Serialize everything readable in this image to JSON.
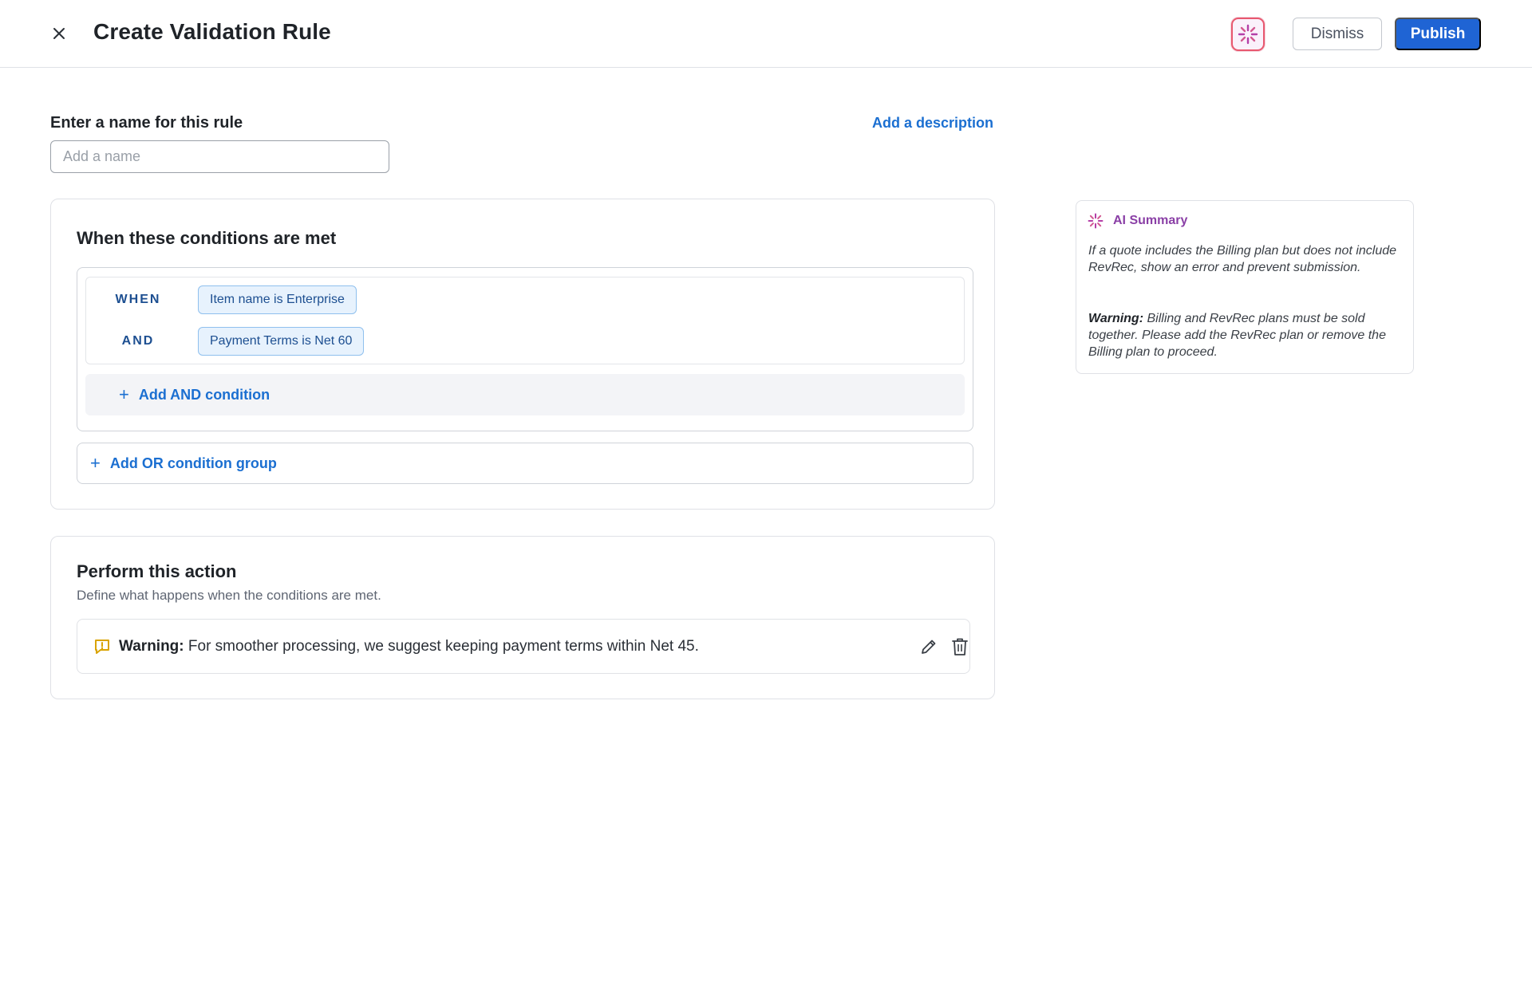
{
  "header": {
    "title": "Create Validation Rule",
    "dismiss_label": "Dismiss",
    "publish_label": "Publish"
  },
  "name_section": {
    "label": "Enter a name for this rule",
    "placeholder": "Add a name",
    "value": "",
    "add_description_label": "Add a description"
  },
  "conditions": {
    "title": "When these conditions are met",
    "rows": [
      {
        "operator": "WHEN",
        "chip": "Item name is Enterprise"
      },
      {
        "operator": "AND",
        "chip": "Payment Terms is Net 60"
      }
    ],
    "add_and_label": "Add AND condition",
    "add_or_label": "Add OR condition group"
  },
  "action": {
    "title": "Perform this action",
    "subtitle": "Define what happens when the conditions are met.",
    "item": {
      "type_label": "Warning:",
      "message": " For smoother processing, we suggest keeping payment terms within Net 45."
    }
  },
  "ai_summary": {
    "title": "AI Summary",
    "summary": "If a quote includes the Billing plan but does not include RevRec, show an error and prevent submission.",
    "warning_label": "Warning:",
    "warning_text": " Billing and RevRec plans must be sold together. Please add the RevRec plan or remove the Billing plan to proceed."
  },
  "colors": {
    "primary": "#1f64d4",
    "link": "#1b6fd1",
    "chip_bg": "#e7f2fd",
    "chip_border": "#8fc0ee",
    "ai_accent": "#8a3fa6",
    "warning_icon": "#d9a300"
  },
  "icons": {
    "close": "close-icon",
    "ai_button": "sparkle-icon",
    "warning": "warning-message-icon",
    "edit": "pencil-icon",
    "delete": "trash-icon"
  }
}
